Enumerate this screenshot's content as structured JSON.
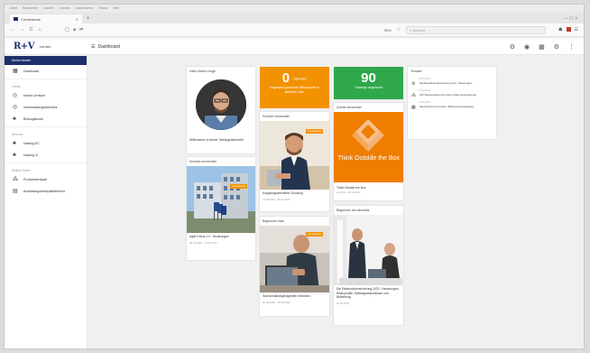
{
  "browser": {
    "menu_items": [
      "Datei",
      "Bearbeiten",
      "Ansicht",
      "Chronik",
      "Lesezeichen",
      "Extras",
      "Hilfe"
    ],
    "tab_title": "Cornerstone",
    "new_tab": "+",
    "window_controls": "—  ☐  ✕",
    "nav": {
      "back": "←",
      "forward": "→",
      "reload": "C",
      "home": "⌂"
    },
    "zoom": "90%",
    "search_placeholder": "Suchen"
  },
  "app": {
    "logo": "R+V",
    "logo_subtitle": "Lernen",
    "header_title": "Dashboard"
  },
  "sidebar": {
    "active_item": "Meine Inhalte",
    "items_top": [
      {
        "label": "Dashboard",
        "icon": "grid-icon"
      }
    ],
    "section_learning": "Lernen",
    "items_learning": [
      {
        "label": "Meine Lernwelt",
        "icon": "globe-icon"
      },
      {
        "label": "Veranstaltungsübersicht",
        "icon": "calendar-icon"
      },
      {
        "label": "Bildungskonto",
        "icon": "coins-icon"
      }
    ],
    "section_services": "Services",
    "items_services": [
      {
        "label": "Katalog EC",
        "icon": "catalog-icon"
      },
      {
        "label": "Katalog IC",
        "icon": "catalog-icon"
      }
    ],
    "section_other": "Weitere Seiten",
    "items_other": [
      {
        "label": "Produktwerkstatt",
        "icon": "people-icon"
      },
      {
        "label": "Ausbildungsreisepaketbericht",
        "icon": "report-icon"
      }
    ]
  },
  "cards": {
    "welcome": {
      "title": "Hallo Martin Kruge",
      "text": "Willkommen in deiner Trainingsübersicht!"
    },
    "recent1": {
      "title": "Kürzlich verwendet",
      "badge": "Lernangebote",
      "text": "Agile Fokus 4.0 - Neuerungen",
      "date": "09.03.2023 · 10.03.2023"
    },
    "tile_orange": {
      "number": "0",
      "unit": "Stunden",
      "label": "Insgesamt gebuchte Bildungszeit in aktuellen Jahr",
      "color": "#f39200"
    },
    "tile_green": {
      "number": "90",
      "label": "Trainings abgebucht",
      "color": "#2ea84a"
    },
    "recent2": {
      "title": "Kürzlich verwendet",
      "badge": "Lernangebote",
      "text": "Kopplungsorientierte Schulung",
      "date": "17.03.2023 · 09.02.2023"
    },
    "recent3": {
      "title": "Zuletzt verwendet",
      "image_title": "Think Outside the Box",
      "text": "Think Outside the Box",
      "date": "Lernbox · 06.03.2023"
    },
    "begun": {
      "title": "Begonnen bald",
      "badge": "Lernangebote",
      "text": "Sachverständigenagenten erkennen",
      "date": "01.09.2022 · 16.08.2022"
    },
    "begun2": {
      "title": "Begonnen als nächstes",
      "text": "Die Elektronikversicherung 2023 - Neuerungen, Risikoprofile, Haftungsausschlüsse und Bewertung",
      "date": "06.03.2023"
    },
    "termine": {
      "title": "Termine",
      "items": [
        {
          "date": "06.03.2023",
          "text": "Sachbearbeitungsschulung Gold - Neuerungen",
          "icon": "gear-icon"
        },
        {
          "date": "07.03.2023",
          "text": "IVD Sachversicherung Intern Online-Sprechstunde",
          "icon": "users-icon"
        },
        {
          "date": "07.03.2023",
          "text": "Sachversicherung intern (Präsenzveranstaltung)",
          "icon": "calendar-icon"
        }
      ]
    }
  },
  "colors": {
    "brand": "#1e2f6b",
    "orange": "#f39200",
    "green": "#2ea84a"
  }
}
